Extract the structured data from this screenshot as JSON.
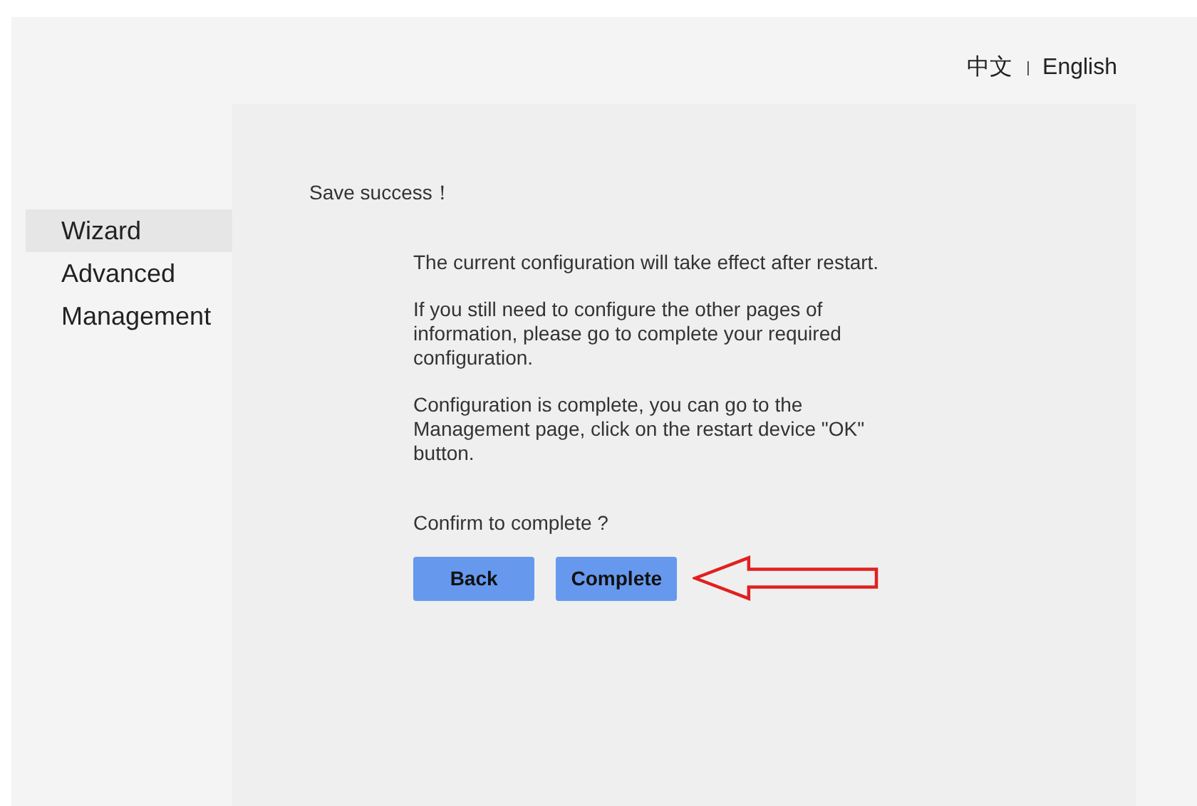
{
  "languages": [
    "中文",
    "English"
  ],
  "sidebar": {
    "items": [
      {
        "label": "Wizard",
        "selected": true
      },
      {
        "label": "Advanced",
        "selected": false
      },
      {
        "label": "Management",
        "selected": false
      }
    ]
  },
  "content": {
    "title": "Save success！",
    "paragraphs": [
      "The current configuration will take effect after restart.",
      "If you still need to configure the other pages of information,  please go to complete your required configuration.",
      "Configuration is complete,  you can go to the Management page,  click on the restart device \"OK\" button."
    ],
    "confirm": "Confirm to complete ?",
    "buttons": [
      "Back",
      "Complete"
    ]
  }
}
